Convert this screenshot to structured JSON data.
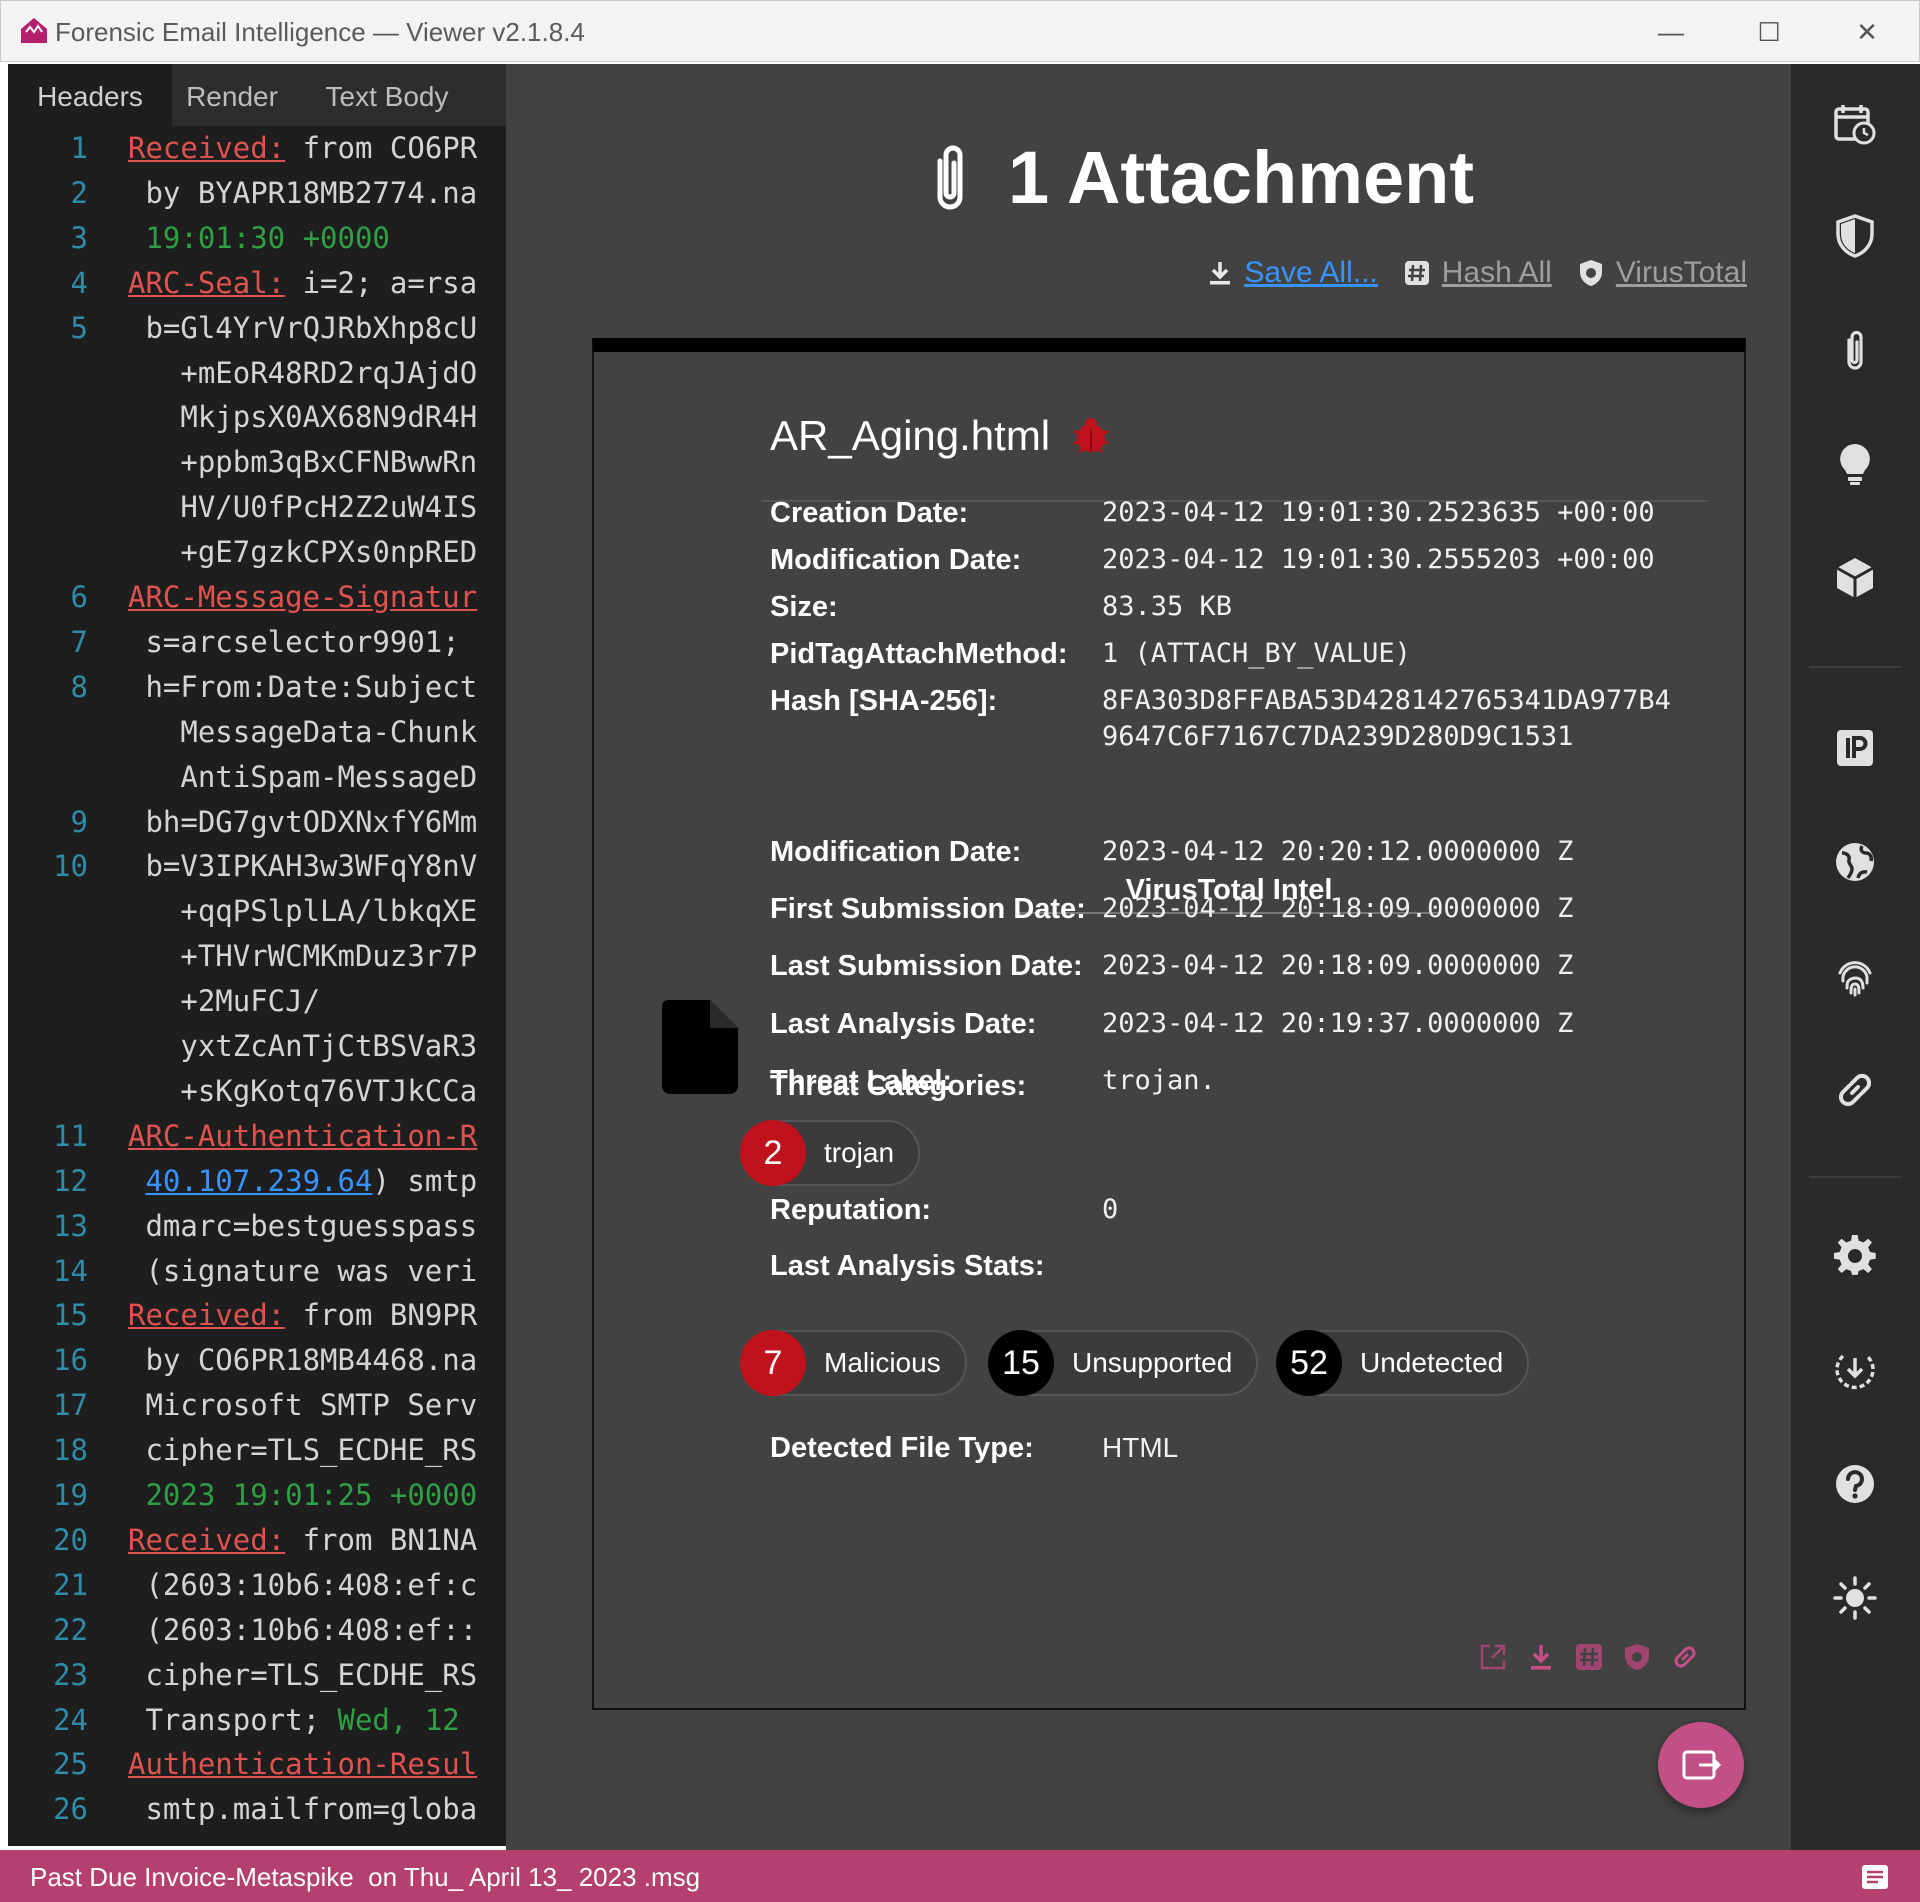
{
  "window": {
    "title": "Forensic Email Intelligence — Viewer v2.1.8.4",
    "minimize": "—",
    "maximize": "☐",
    "close": "✕"
  },
  "left_pane": {
    "tabs": [
      "Headers",
      "Render",
      "Text Body"
    ],
    "lines": [
      {
        "n": "1",
        "segments": [
          {
            "t": "Received:",
            "c": "hdr"
          },
          {
            "t": " from CO6PR",
            "c": ""
          }
        ]
      },
      {
        "n": "2",
        "segments": [
          {
            "t": " by BYAPR18MB2774.na",
            "c": ""
          }
        ]
      },
      {
        "n": "3",
        "segments": [
          {
            "t": " 19:01:30 +0000",
            "c": "grn"
          }
        ]
      },
      {
        "n": "4",
        "segments": [
          {
            "t": "ARC-Seal:",
            "c": "hdr"
          },
          {
            "t": " i=2; a=rsa",
            "c": ""
          }
        ]
      },
      {
        "n": "5",
        "segments": [
          {
            "t": " b=Gl4YrVrQJRbXhp8cU",
            "c": ""
          }
        ]
      },
      {
        "n": "",
        "segments": [
          {
            "t": "   +mEoR48RD2rqJAjdO",
            "c": ""
          }
        ]
      },
      {
        "n": "",
        "segments": [
          {
            "t": "   MkjpsX0AX68N9dR4H",
            "c": ""
          }
        ]
      },
      {
        "n": "",
        "segments": [
          {
            "t": "   +ppbm3qBxCFNBwwRn",
            "c": ""
          }
        ]
      },
      {
        "n": "",
        "segments": [
          {
            "t": "   HV/U0fPcH2Z2uW4IS",
            "c": ""
          }
        ]
      },
      {
        "n": "",
        "segments": [
          {
            "t": "   +gE7gzkCPXs0npRED",
            "c": ""
          }
        ]
      },
      {
        "n": "6",
        "segments": [
          {
            "t": "ARC-Message-Signatur",
            "c": "hdr"
          }
        ]
      },
      {
        "n": "7",
        "segments": [
          {
            "t": " s=arcselector9901;",
            "c": ""
          }
        ]
      },
      {
        "n": "8",
        "segments": [
          {
            "t": " h=From:Date:Subject",
            "c": ""
          }
        ]
      },
      {
        "n": "",
        "segments": [
          {
            "t": "   MessageData-Chunk",
            "c": ""
          }
        ]
      },
      {
        "n": "",
        "segments": [
          {
            "t": "   AntiSpam-MessageD",
            "c": ""
          }
        ]
      },
      {
        "n": "9",
        "segments": [
          {
            "t": " bh=DG7gvtODXNxfY6Mm",
            "c": ""
          }
        ]
      },
      {
        "n": "10",
        "segments": [
          {
            "t": " b=V3IPKAH3w3WFqY8nV",
            "c": ""
          }
        ]
      },
      {
        "n": "",
        "segments": [
          {
            "t": "   +qqPSlplLA/lbkqXE",
            "c": ""
          }
        ]
      },
      {
        "n": "",
        "segments": [
          {
            "t": "   +THVrWCMKmDuz3r7P",
            "c": ""
          }
        ]
      },
      {
        "n": "",
        "segments": [
          {
            "t": "   +2MuFCJ/",
            "c": ""
          }
        ]
      },
      {
        "n": "",
        "segments": [
          {
            "t": "   yxtZcAnTjCtBSVaR3",
            "c": ""
          }
        ]
      },
      {
        "n": "",
        "segments": [
          {
            "t": "   +sKgKotq76VTJkCCa",
            "c": ""
          }
        ]
      },
      {
        "n": "11",
        "segments": [
          {
            "t": "ARC-Authentication-R",
            "c": "hdr"
          }
        ]
      },
      {
        "n": "12",
        "segments": [
          {
            "t": " ",
            "c": ""
          },
          {
            "t": "40.107.239.64",
            "c": "lnk"
          },
          {
            "t": ") smtp",
            "c": ""
          }
        ]
      },
      {
        "n": "13",
        "segments": [
          {
            "t": " dmarc=bestguesspass",
            "c": ""
          }
        ]
      },
      {
        "n": "14",
        "segments": [
          {
            "t": " (signature was veri",
            "c": ""
          }
        ]
      },
      {
        "n": "15",
        "segments": [
          {
            "t": "Received:",
            "c": "hdr"
          },
          {
            "t": " from BN9PR",
            "c": ""
          }
        ]
      },
      {
        "n": "16",
        "segments": [
          {
            "t": " by CO6PR18MB4468.na",
            "c": ""
          }
        ]
      },
      {
        "n": "17",
        "segments": [
          {
            "t": " Microsoft SMTP Serv",
            "c": ""
          }
        ]
      },
      {
        "n": "18",
        "segments": [
          {
            "t": " cipher=TLS_ECDHE_RS",
            "c": ""
          }
        ]
      },
      {
        "n": "19",
        "segments": [
          {
            "t": " 2023 19:01:25 +0000",
            "c": "grn"
          }
        ]
      },
      {
        "n": "20",
        "segments": [
          {
            "t": "Received:",
            "c": "hdr"
          },
          {
            "t": " from BN1NA",
            "c": ""
          }
        ]
      },
      {
        "n": "21",
        "segments": [
          {
            "t": " (2603:10b6:408:ef:c",
            "c": ""
          }
        ]
      },
      {
        "n": "22",
        "segments": [
          {
            "t": " (2603:10b6:408:ef::",
            "c": ""
          }
        ]
      },
      {
        "n": "23",
        "segments": [
          {
            "t": " cipher=TLS_ECDHE_RS",
            "c": ""
          }
        ]
      },
      {
        "n": "24",
        "segments": [
          {
            "t": " Transport; ",
            "c": ""
          },
          {
            "t": "Wed, 12",
            "c": "grn"
          }
        ]
      },
      {
        "n": "25",
        "segments": [
          {
            "t": "Authentication-Resul",
            "c": "hdr"
          }
        ]
      },
      {
        "n": "26",
        "segments": [
          {
            "t": " smtp.mailfrom=globa",
            "c": ""
          }
        ]
      }
    ]
  },
  "header": {
    "title": "1 Attachment",
    "actions": {
      "save_all": "Save All...",
      "hash_all": "Hash All",
      "virustotal": "VirusTotal"
    }
  },
  "attachment": {
    "file_name": "AR_Aging.html",
    "fields": [
      {
        "label": "Creation Date:",
        "value": "2023-04-12 19:01:30.2523635 +00:00"
      },
      {
        "label": "Modification Date:",
        "value": "2023-04-12 19:01:30.2555203 +00:00"
      },
      {
        "label": "Size:",
        "value": "83.35 KB"
      },
      {
        "label": "PidTagAttachMethod:",
        "value": "1 (ATTACH_BY_VALUE)"
      },
      {
        "label": "Hash [SHA-256]:",
        "value": "8FA303D8FFABA53D428142765341DA977B4\n9647C6F7167C7DA239D280D9C1531"
      }
    ],
    "virustotal": {
      "title": "VirusTotal Intel",
      "fields": [
        {
          "label": "Modification Date:",
          "value": "2023-04-12 20:20:12.0000000 Z"
        },
        {
          "label": "First Submission Date:",
          "value": "2023-04-12 20:18:09.0000000 Z"
        },
        {
          "label": "Last Submission Date:",
          "value": "2023-04-12 20:18:09.0000000 Z"
        },
        {
          "label": "Last Analysis Date:",
          "value": "2023-04-12 20:19:37.0000000 Z"
        },
        {
          "label": "Threat Label:",
          "value": "trojan."
        }
      ],
      "threat_categories_label": "Threat Categories:",
      "threat_categories": [
        {
          "count": "2",
          "label": "trojan"
        }
      ],
      "reputation_label": "Reputation:",
      "reputation": "0",
      "stats_label": "Last Analysis Stats:",
      "stats": [
        {
          "count": "7",
          "label": "Malicious",
          "color": "#c0121c"
        },
        {
          "count": "15",
          "label": "Unsupported",
          "color": "#000000"
        },
        {
          "count": "52",
          "label": "Undetected",
          "color": "#000000"
        }
      ],
      "detected_file_type_label": "Detected File Type:",
      "detected_file_type": "HTML"
    }
  },
  "sidebar_icons": [
    "calendar-clock-icon",
    "shield-icon",
    "paperclip-icon",
    "lightbulb-icon",
    "cube-icon",
    "ip-icon",
    "globe-icon",
    "fingerprint-icon",
    "link-icon",
    "gear-icon",
    "download-circle-icon",
    "help-icon",
    "brightness-icon"
  ],
  "status_bar": {
    "text": "Past Due Invoice-Metaspike  on Thu_ April 13_ 2023 .msg"
  },
  "colors": {
    "accent": "#b3406f",
    "link": "#3794ff",
    "malicious": "#c0121c",
    "code_header": "#e0524f",
    "code_green": "#2ea043"
  }
}
